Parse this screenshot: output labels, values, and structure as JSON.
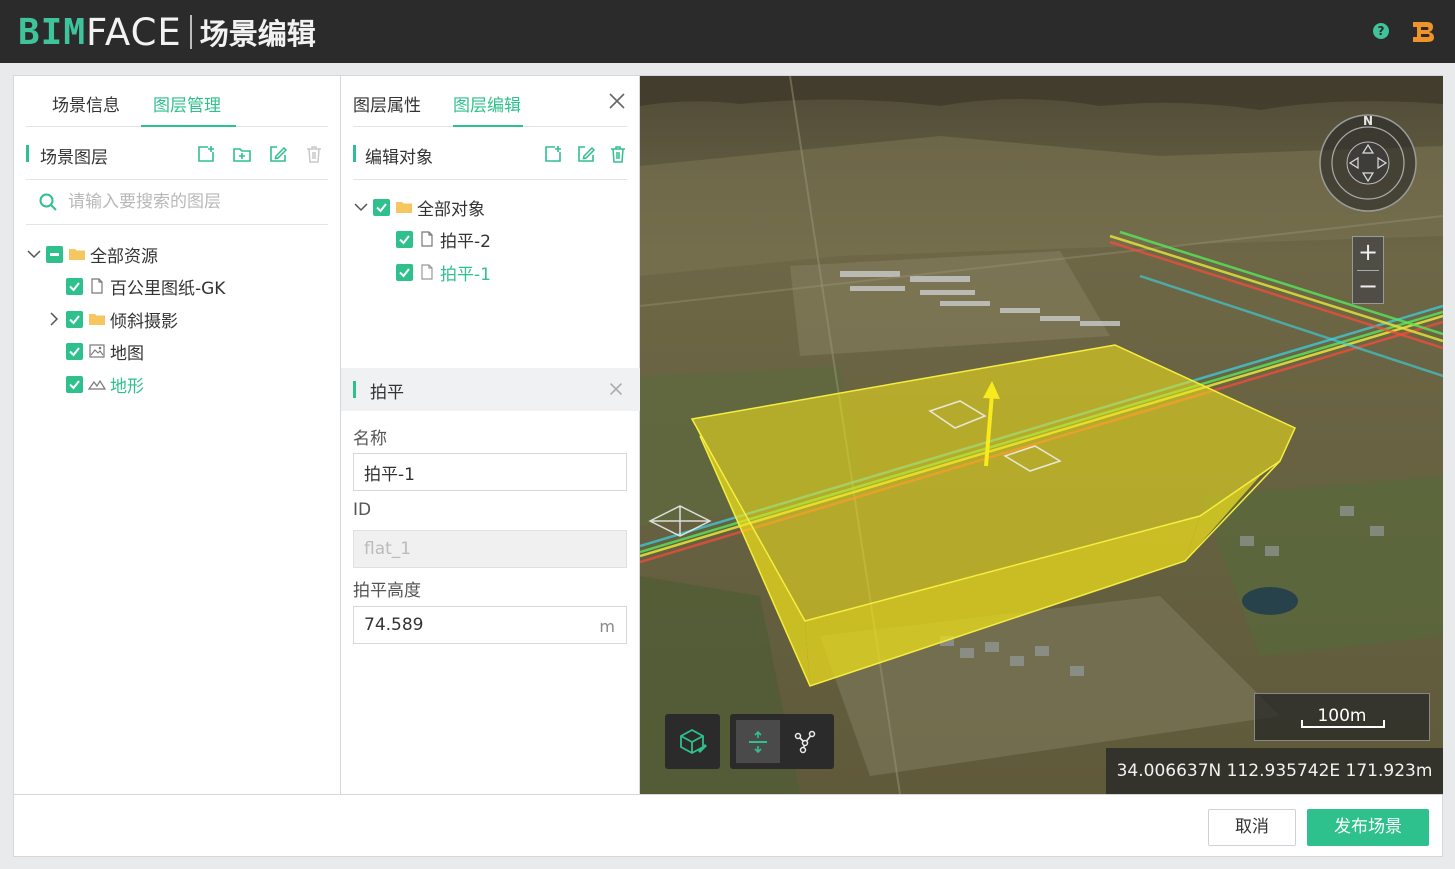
{
  "app": {
    "logo_bim": "BIM",
    "logo_face": "FACE",
    "title": "场景编辑",
    "help_icon": "question-circle-icon",
    "brand_icon": "bimface-b-icon"
  },
  "left_panel": {
    "tabs": [
      {
        "label": "场景信息",
        "active": false
      },
      {
        "label": "图层管理",
        "active": true
      }
    ],
    "section_title": "场景图层",
    "tools": [
      "add-layer-icon",
      "add-folder-icon",
      "edit-icon",
      "delete-icon"
    ],
    "search_placeholder": "请输入要搜索的图层",
    "tree": [
      {
        "label": "全部资源",
        "type": "folder",
        "checked": "indeterminate",
        "expanded": true
      },
      {
        "label": "百公里图纸-GK",
        "type": "file",
        "checked": true
      },
      {
        "label": "倾斜摄影",
        "type": "folder",
        "checked": true,
        "expanded": false
      },
      {
        "label": "地图",
        "type": "map",
        "checked": true
      },
      {
        "label": "地形",
        "type": "terrain",
        "checked": true,
        "active": true
      }
    ]
  },
  "mid_panel": {
    "tabs": [
      {
        "label": "图层属性",
        "active": false
      },
      {
        "label": "图层编辑",
        "active": true
      }
    ],
    "section_title": "编辑对象",
    "tools": [
      "add-object-icon",
      "edit-icon",
      "delete-icon"
    ],
    "tree": [
      {
        "label": "全部对象",
        "type": "folder",
        "checked": true,
        "expanded": true
      },
      {
        "label": "拍平-2",
        "type": "file",
        "checked": true
      },
      {
        "label": "拍平-1",
        "type": "file",
        "checked": true,
        "active": true
      }
    ],
    "props": {
      "title": "拍平",
      "name_label": "名称",
      "name_value": "拍平-1",
      "id_label": "ID",
      "id_value": "flat_1",
      "height_label": "拍平高度",
      "height_value": "74.589",
      "height_unit": "m"
    }
  },
  "map": {
    "compass_label": "N",
    "zoom_in": "+",
    "zoom_out": "−",
    "scale": "100m",
    "coords": "34.006637N  112.935742E  171.923m",
    "tools": [
      "cube-edit-icon",
      "flatten-icon",
      "vertex-edit-icon"
    ]
  },
  "footer": {
    "cancel": "取消",
    "publish": "发布场景"
  },
  "colors": {
    "accent": "#2fc18d",
    "header_bg": "#2b2b2b",
    "flatten_fill": "#f5e61a"
  }
}
